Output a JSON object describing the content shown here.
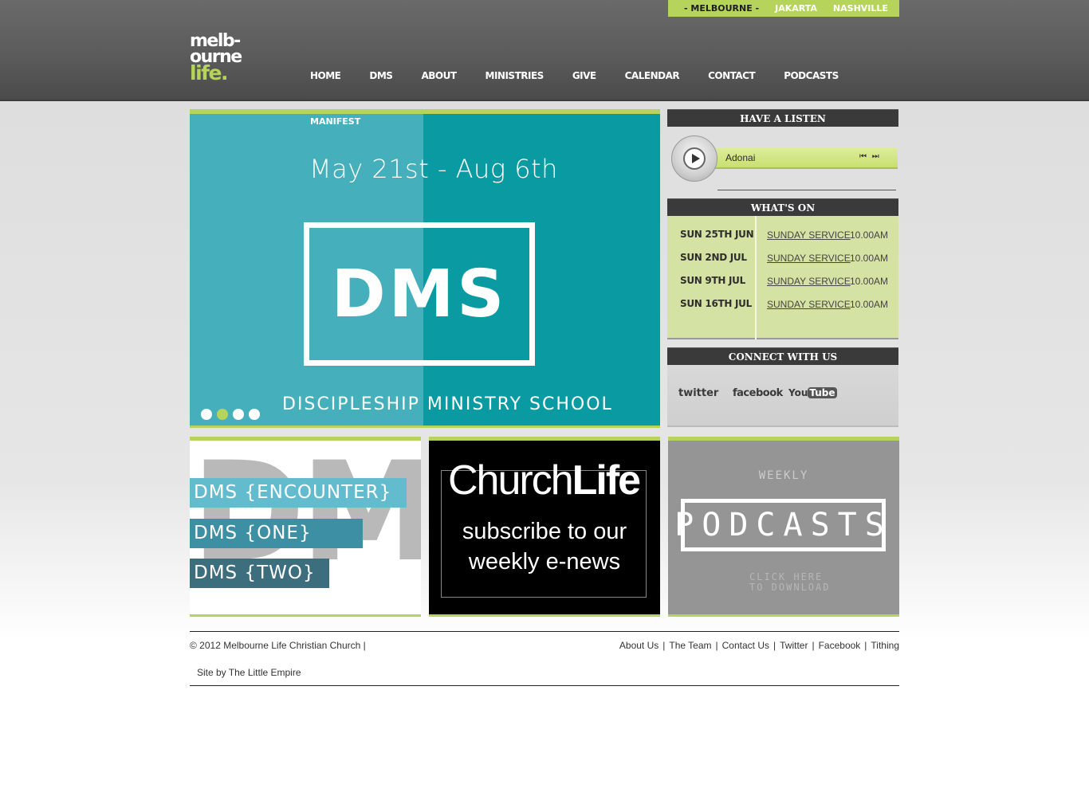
{
  "cities": {
    "active": "- MELBOURNE -",
    "others": [
      "JAKARTA",
      "NASHVILLE"
    ]
  },
  "logo": {
    "line1": "melb-",
    "line2": "ourne",
    "line3": "life."
  },
  "nav": [
    "HOME",
    "DMS",
    "ABOUT",
    "MINISTRIES",
    "GIVE",
    "CALENDAR",
    "CONTACT",
    "PODCASTS"
  ],
  "hero": {
    "label": "MANIFEST",
    "dates": "May 21st - Aug 6th",
    "big": "DMS",
    "subtitle": "DISCIPLESHIP MINISTRY SCHOOL",
    "slide_count": 4,
    "active_slide": 2
  },
  "listen": {
    "heading": "HAVE A LISTEN",
    "track": "Adonai",
    "controls": "⏮ ⏭"
  },
  "whats_on": {
    "heading": "WHAT'S ON",
    "events": [
      {
        "date": "SUN 25TH JUN",
        "service": "SUNDAY SERVICE",
        "time": "10.00AM"
      },
      {
        "date": "SUN 2ND JUL",
        "service": "SUNDAY SERVICE",
        "time": "10.00AM"
      },
      {
        "date": "SUN 9TH JUL",
        "service": "SUNDAY SERVICE",
        "time": "10.00AM"
      },
      {
        "date": "SUN 16TH JUL",
        "service": "SUNDAY SERVICE",
        "time": "10.00AM"
      }
    ]
  },
  "connect": {
    "heading": "CONNECT WITH US",
    "twitter": "twitter",
    "facebook": "facebook",
    "youtube_you": "You",
    "youtube_tube": "Tube"
  },
  "box_dms": {
    "bg": "DMS",
    "items": [
      "DMS {ENCOUNTER}",
      "DMS {ONE}",
      "DMS {TWO}"
    ]
  },
  "box_news": {
    "title_a": "Church",
    "title_b": "Life",
    "line1": "subscribe to our",
    "line2": "weekly e-news"
  },
  "box_podcasts": {
    "weekly": "WEEKLY",
    "title": "PODCASTS",
    "line1": "CLICK HERE",
    "line2": "TO DOWNLOAD"
  },
  "footer": {
    "copyright": "© 2012 Melbourne Life Christian Church  |",
    "links": [
      "About Us",
      "The Team",
      "Contact Us",
      "Twitter",
      "Facebook",
      "Tithing"
    ],
    "siteby": "Site by The Little Empire"
  }
}
